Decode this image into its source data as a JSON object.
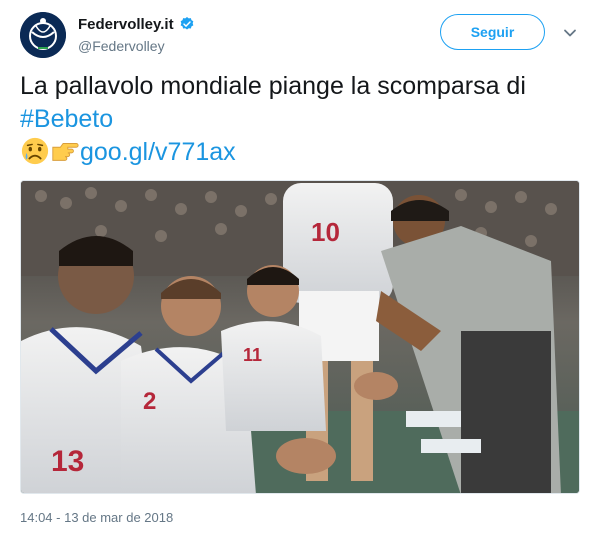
{
  "user": {
    "display_name": "Federvolley.it",
    "screen_name": "@Federvolley",
    "verified": true
  },
  "follow_button": {
    "label": "Seguir"
  },
  "tweet": {
    "text_line1": "La pallavolo mondiale piange la scomparsa di",
    "hashtag": "#Bebeto",
    "emojis": [
      "crying-face",
      "pointing-right"
    ],
    "link": "goo.gl/v771ax"
  },
  "media": {
    "jersey_numbers": [
      "10",
      "2",
      "11",
      "13"
    ],
    "description_icon": "team-photo"
  },
  "timestamp": "14:04 - 13 de mar de 2018",
  "colors": {
    "accent": "#1da1f2",
    "link": "#1b95e0",
    "secondary_text": "#657786"
  }
}
